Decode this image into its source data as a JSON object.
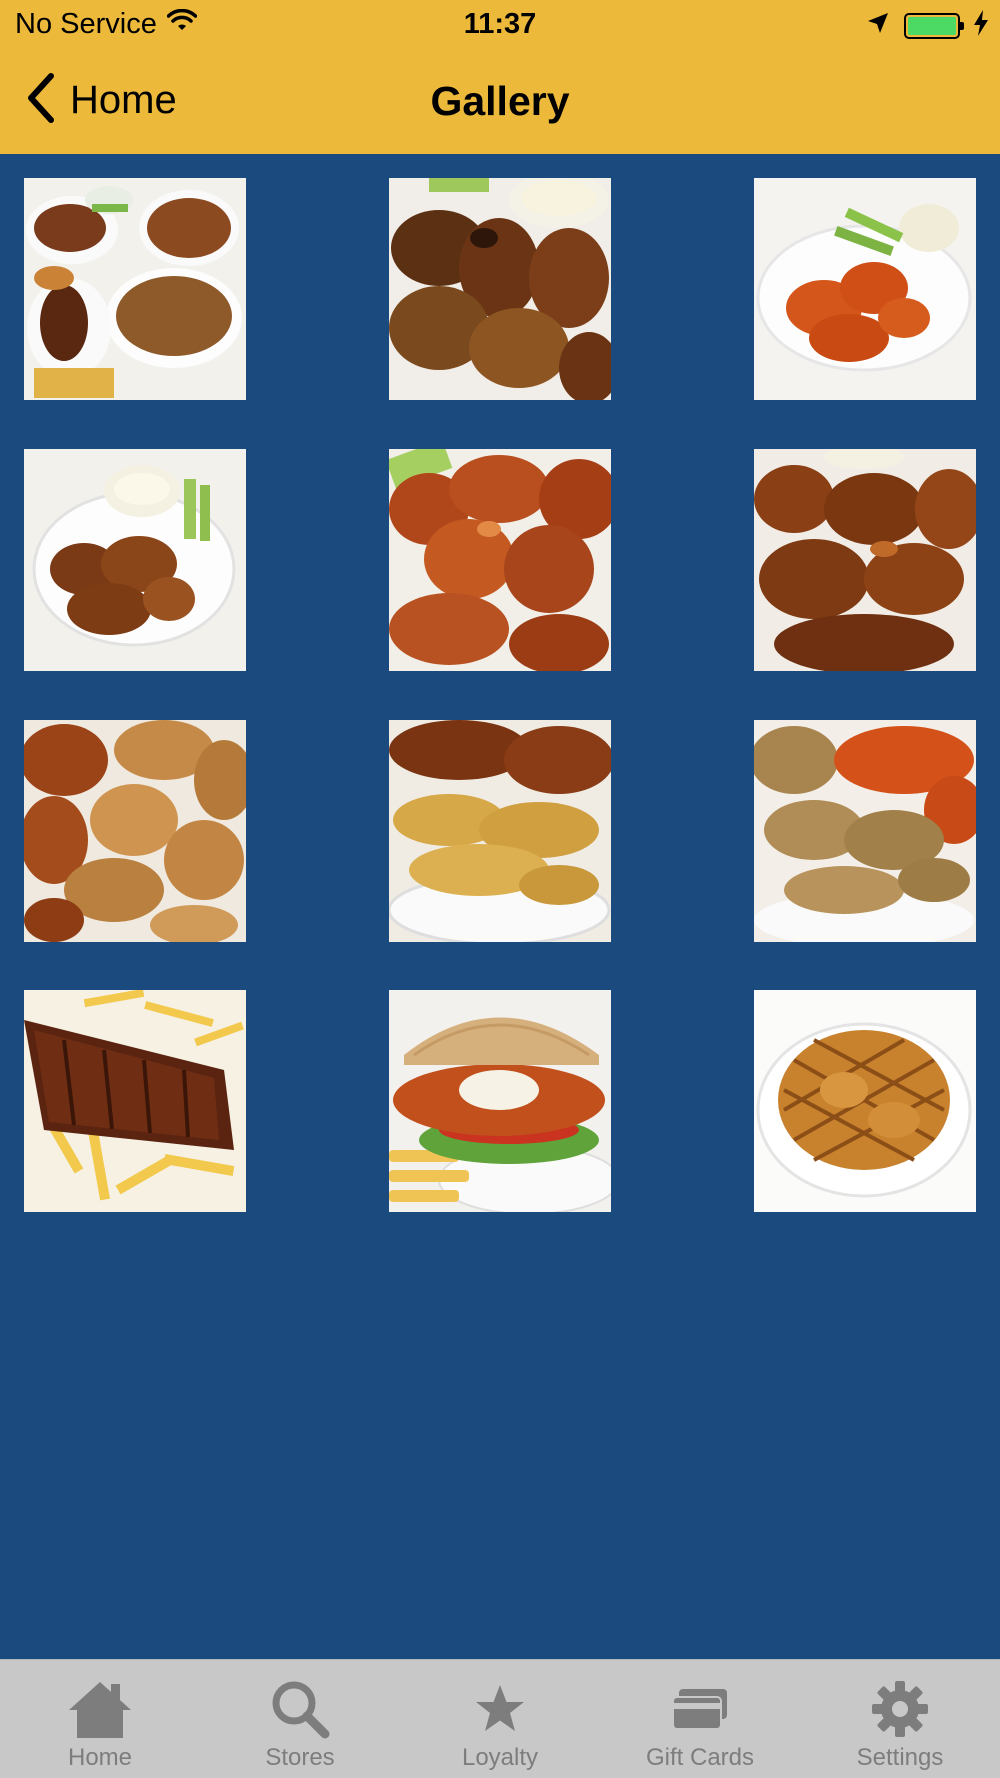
{
  "status_bar": {
    "carrier": "No Service",
    "time": "11:37",
    "battery_color": "#4cd964",
    "icons": [
      "wifi-icon",
      "location-arrow-icon",
      "battery-icon",
      "charging-bolt-icon"
    ]
  },
  "nav": {
    "back_label": "Home",
    "title": "Gallery",
    "background": "#ecb93b"
  },
  "gallery": {
    "background": "#1a4a7e",
    "images": [
      {
        "name": "platter-assortment"
      },
      {
        "name": "grilled-wings-with-dip"
      },
      {
        "name": "buffalo-tenders-plate"
      },
      {
        "name": "bbq-wings-plate"
      },
      {
        "name": "buffalo-wings-closeup"
      },
      {
        "name": "glazed-tenders-closeup"
      },
      {
        "name": "mixed-wings-closeup"
      },
      {
        "name": "honey-mustard-tenders"
      },
      {
        "name": "cajun-tenders"
      },
      {
        "name": "ribs-and-fries"
      },
      {
        "name": "buffalo-chicken-sandwich"
      },
      {
        "name": "waffle-fries"
      }
    ]
  },
  "tab_bar": {
    "background": "#c8c8c8",
    "label_color": "#7d7d7d",
    "tabs": [
      {
        "label": "Home",
        "icon": "house-icon"
      },
      {
        "label": "Stores",
        "icon": "search-icon"
      },
      {
        "label": "Loyalty",
        "icon": "star-icon"
      },
      {
        "label": "Gift Cards",
        "icon": "gift-cards-icon"
      },
      {
        "label": "Settings",
        "icon": "gear-icon"
      }
    ]
  }
}
